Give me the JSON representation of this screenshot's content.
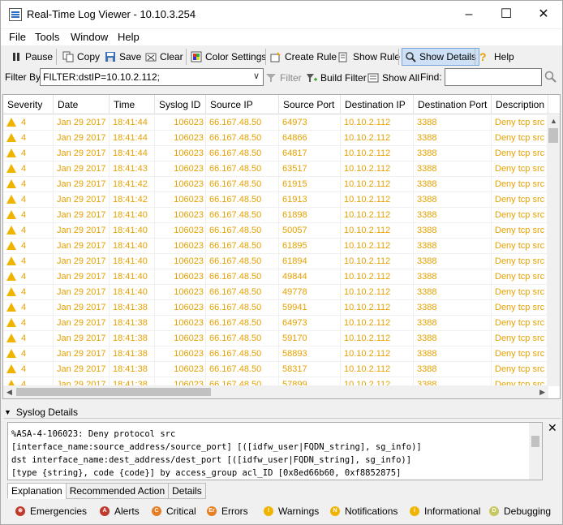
{
  "window": {
    "title": "Real-Time Log Viewer - 10.10.3.254",
    "minimize": "–",
    "maximize": "☐",
    "close": "✕"
  },
  "menu": [
    "File",
    "Tools",
    "Window",
    "Help"
  ],
  "toolbar": {
    "pause": "Pause",
    "copy": "Copy",
    "save": "Save",
    "clear": "Clear",
    "color_settings": "Color Settings",
    "create_rule": "Create Rule",
    "show_rule": "Show Rule",
    "show_details": "Show Details",
    "help": "Help"
  },
  "filterbar": {
    "label": "Filter By:",
    "value": "FILTER:dstIP=10.10.2.112;",
    "filter": "Filter",
    "build_filter": "Build Filter",
    "show_all": "Show All",
    "find_label": "Find:"
  },
  "grid": {
    "columns": [
      "Severity",
      "Date",
      "Time",
      "Syslog ID",
      "Source IP",
      "Source Port",
      "Destination IP",
      "Destination Port",
      "Description"
    ],
    "rows": [
      [
        "4",
        "Jan 29 2017",
        "18:41:44",
        "106023",
        "66.167.48.50",
        "64973",
        "10.10.2.112",
        "3388",
        "Deny tcp src"
      ],
      [
        "4",
        "Jan 29 2017",
        "18:41:44",
        "106023",
        "66.167.48.50",
        "64866",
        "10.10.2.112",
        "3388",
        "Deny tcp src"
      ],
      [
        "4",
        "Jan 29 2017",
        "18:41:44",
        "106023",
        "66.167.48.50",
        "64817",
        "10.10.2.112",
        "3388",
        "Deny tcp src"
      ],
      [
        "4",
        "Jan 29 2017",
        "18:41:43",
        "106023",
        "66.167.48.50",
        "63517",
        "10.10.2.112",
        "3388",
        "Deny tcp src"
      ],
      [
        "4",
        "Jan 29 2017",
        "18:41:42",
        "106023",
        "66.167.48.50",
        "61915",
        "10.10.2.112",
        "3388",
        "Deny tcp src"
      ],
      [
        "4",
        "Jan 29 2017",
        "18:41:42",
        "106023",
        "66.167.48.50",
        "61913",
        "10.10.2.112",
        "3388",
        "Deny tcp src"
      ],
      [
        "4",
        "Jan 29 2017",
        "18:41:40",
        "106023",
        "66.167.48.50",
        "61898",
        "10.10.2.112",
        "3388",
        "Deny tcp src"
      ],
      [
        "4",
        "Jan 29 2017",
        "18:41:40",
        "106023",
        "66.167.48.50",
        "50057",
        "10.10.2.112",
        "3388",
        "Deny tcp src"
      ],
      [
        "4",
        "Jan 29 2017",
        "18:41:40",
        "106023",
        "66.167.48.50",
        "61895",
        "10.10.2.112",
        "3388",
        "Deny tcp src"
      ],
      [
        "4",
        "Jan 29 2017",
        "18:41:40",
        "106023",
        "66.167.48.50",
        "61894",
        "10.10.2.112",
        "3388",
        "Deny tcp src"
      ],
      [
        "4",
        "Jan 29 2017",
        "18:41:40",
        "106023",
        "66.167.48.50",
        "49844",
        "10.10.2.112",
        "3388",
        "Deny tcp src"
      ],
      [
        "4",
        "Jan 29 2017",
        "18:41:40",
        "106023",
        "66.167.48.50",
        "49778",
        "10.10.2.112",
        "3388",
        "Deny tcp src"
      ],
      [
        "4",
        "Jan 29 2017",
        "18:41:38",
        "106023",
        "66.167.48.50",
        "59941",
        "10.10.2.112",
        "3388",
        "Deny tcp src"
      ],
      [
        "4",
        "Jan 29 2017",
        "18:41:38",
        "106023",
        "66.167.48.50",
        "64973",
        "10.10.2.112",
        "3388",
        "Deny tcp src"
      ],
      [
        "4",
        "Jan 29 2017",
        "18:41:38",
        "106023",
        "66.167.48.50",
        "59170",
        "10.10.2.112",
        "3388",
        "Deny tcp src"
      ],
      [
        "4",
        "Jan 29 2017",
        "18:41:38",
        "106023",
        "66.167.48.50",
        "58893",
        "10.10.2.112",
        "3388",
        "Deny tcp src"
      ],
      [
        "4",
        "Jan 29 2017",
        "18:41:38",
        "106023",
        "66.167.48.50",
        "58317",
        "10.10.2.112",
        "3388",
        "Deny tcp src"
      ],
      [
        "4",
        "Jan 29 2017",
        "18:41:38",
        "106023",
        "66.167.48.50",
        "57899",
        "10.10.2.112",
        "3388",
        "Deny tcp src"
      ]
    ],
    "row_color": "#e5a100"
  },
  "details": {
    "title": "Syslog Details",
    "lines": [
      "%ASA-4-106023: Deny protocol src",
      "[interface_name:source_address/source_port] [([idfw_user|FQDN_string], sg_info)]",
      "dst interface_name:dest_address/dest_port [([idfw_user|FQDN_string], sg_info)]",
      "[type {string}, code {code}] by access_group acl_ID [0x8ed66b60, 0xf8852875]"
    ],
    "tabs": [
      "Explanation",
      "Recommended Action",
      "Details"
    ],
    "close": "✕"
  },
  "legend": [
    {
      "label": "Emergencies",
      "color": "#c0392b",
      "glyph": "⊗"
    },
    {
      "label": "Alerts",
      "color": "#c0392b",
      "glyph": "A"
    },
    {
      "label": "Critical",
      "color": "#e67e22",
      "glyph": "C"
    },
    {
      "label": "Errors",
      "color": "#e67e22",
      "glyph": "Er"
    },
    {
      "label": "Warnings",
      "color": "#f0b400",
      "glyph": "!"
    },
    {
      "label": "Notifications",
      "color": "#f0b400",
      "glyph": "N"
    },
    {
      "label": "Informational",
      "color": "#f0b400",
      "glyph": "i"
    },
    {
      "label": "Debugging",
      "color": "#c8c860",
      "glyph": "D"
    }
  ]
}
